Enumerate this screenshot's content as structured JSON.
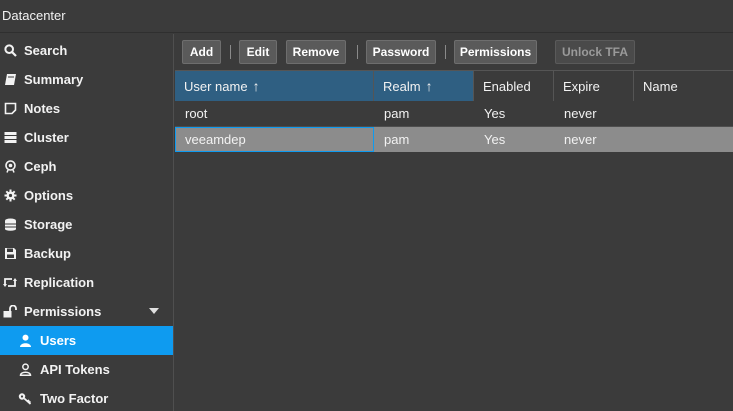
{
  "window": {
    "title": "Datacenter"
  },
  "sidebar": {
    "items": [
      {
        "label": "Search",
        "icon": "search-icon"
      },
      {
        "label": "Summary",
        "icon": "book-icon"
      },
      {
        "label": "Notes",
        "icon": "note-icon"
      },
      {
        "label": "Cluster",
        "icon": "server-icon"
      },
      {
        "label": "Ceph",
        "icon": "ceph-icon"
      },
      {
        "label": "Options",
        "icon": "gear-icon"
      },
      {
        "label": "Storage",
        "icon": "database-icon"
      },
      {
        "label": "Backup",
        "icon": "floppy-icon"
      },
      {
        "label": "Replication",
        "icon": "retweet-icon"
      },
      {
        "label": "Permissions",
        "icon": "unlock-icon"
      },
      {
        "label": "Users",
        "icon": "user-icon"
      },
      {
        "label": "API Tokens",
        "icon": "user-outline-icon"
      },
      {
        "label": "Two Factor",
        "icon": "key-icon"
      }
    ]
  },
  "toolbar": {
    "add": "Add",
    "edit": "Edit",
    "remove": "Remove",
    "password": "Password",
    "permissions": "Permissions",
    "unlock_tfa": "Unlock TFA"
  },
  "grid": {
    "columns": [
      "User name",
      "Realm",
      "Enabled",
      "Expire",
      "Name"
    ],
    "sort_arrow": "↑",
    "rows": [
      [
        "root",
        "pam",
        "Yes",
        "never",
        ""
      ],
      [
        "veeamdep",
        "pam",
        "Yes",
        "never",
        ""
      ]
    ]
  },
  "colors": {
    "accent": "#0e9bf0",
    "header_sorted": "#2f5f82",
    "selected_row": "#8c8c8c"
  }
}
